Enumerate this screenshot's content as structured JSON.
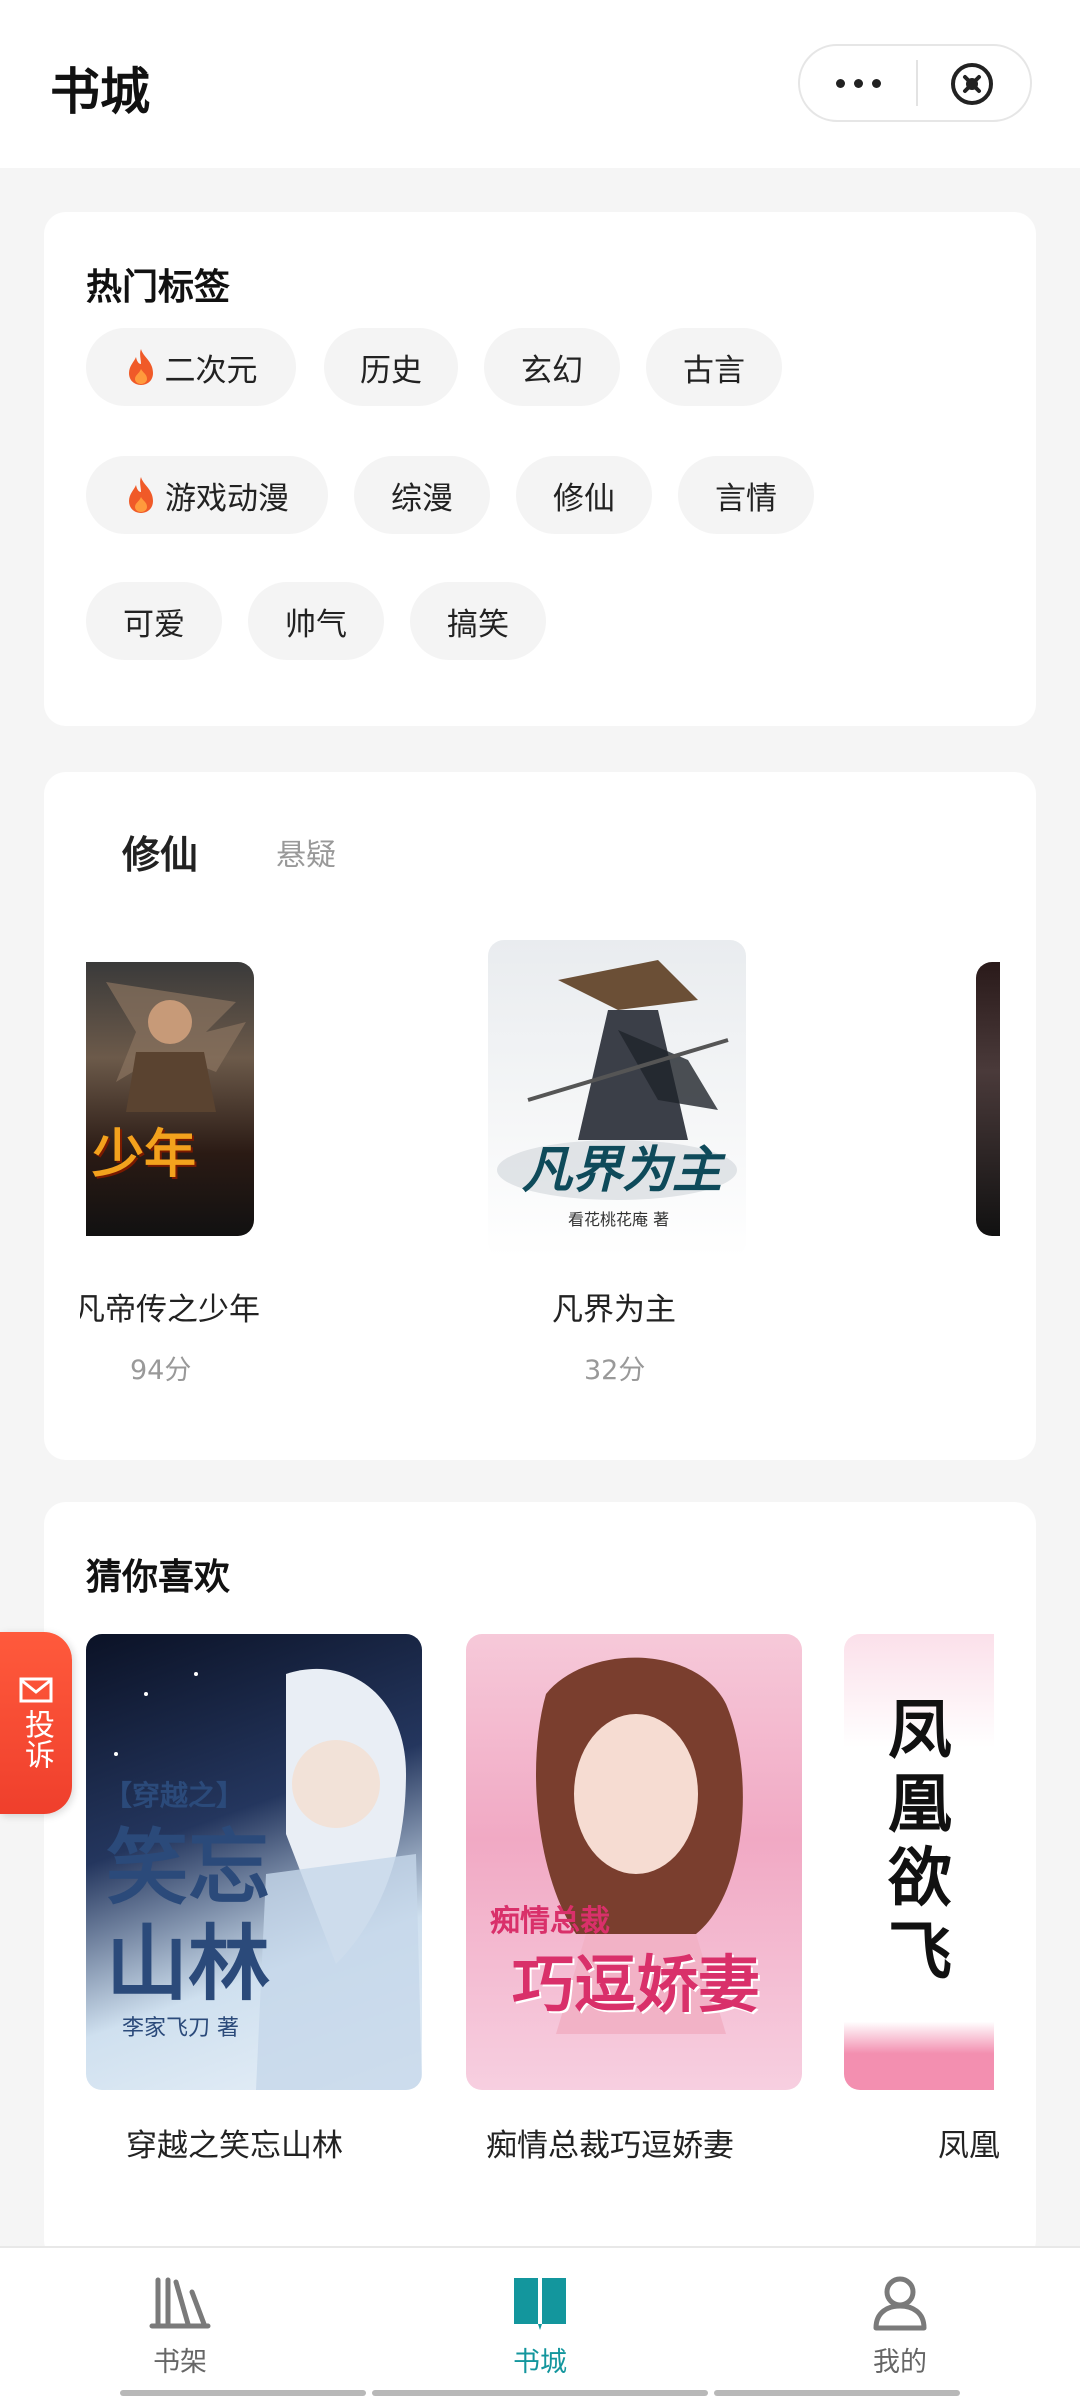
{
  "header": {
    "title": "书城"
  },
  "hot_tags": {
    "title": "热门标签",
    "rows": [
      [
        {
          "label": "二次元",
          "hot": true
        },
        {
          "label": "历史"
        },
        {
          "label": "玄幻"
        },
        {
          "label": "古言"
        }
      ],
      [
        {
          "label": "游戏动漫",
          "hot": true
        },
        {
          "label": "综漫"
        },
        {
          "label": "修仙"
        },
        {
          "label": "言情"
        }
      ],
      [
        {
          "label": "可爱"
        },
        {
          "label": "帅气"
        },
        {
          "label": "搞笑"
        }
      ]
    ]
  },
  "category": {
    "tabs": [
      "修仙",
      "悬疑"
    ],
    "books": [
      {
        "title": "凡帝传之少年",
        "score": "94分",
        "cover_caption": "少年"
      },
      {
        "title": "凡界为主",
        "score": "32分",
        "cover_caption": "凡界为主",
        "cover_author": "看花桃花庵 著"
      }
    ]
  },
  "recommend": {
    "title": "猜你喜欢",
    "books": [
      {
        "title": "穿越之笑忘山林",
        "cover_caption": "笑忘山林",
        "cover_tag": "【穿越之】",
        "cover_author": "李家飞刀 著"
      },
      {
        "title": "痴情总裁巧逗娇妻",
        "cover_caption": "巧逗娇妻",
        "cover_tag": "痴情总裁"
      },
      {
        "title": "凤凰欲飞",
        "cover_caption": "凤凰欲飞"
      }
    ]
  },
  "complain": {
    "label": "投诉"
  },
  "nav": {
    "items": [
      "书架",
      "书城",
      "我的"
    ],
    "active_color": "#13969d"
  }
}
